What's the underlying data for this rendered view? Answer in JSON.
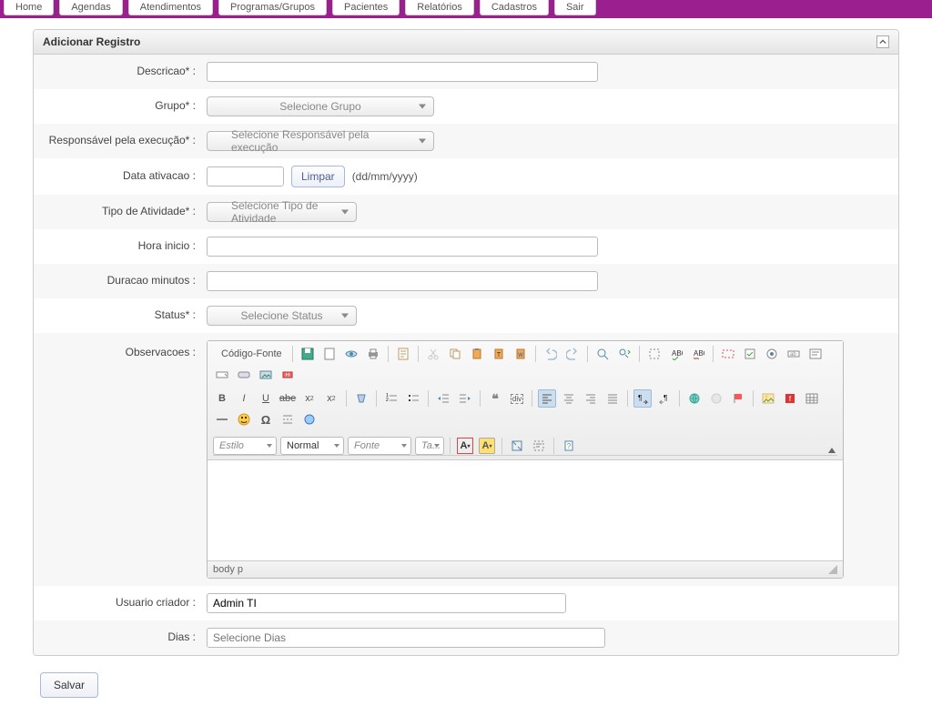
{
  "nav": {
    "items": [
      "Home",
      "Agendas",
      "Atendimentos",
      "Programas/Grupos",
      "Pacientes",
      "Relatórios",
      "Cadastros",
      "Sair"
    ]
  },
  "panel": {
    "title": "Adicionar Registro"
  },
  "labels": {
    "descricao": "Descricao* :",
    "grupo": "Grupo* :",
    "responsavel": "Responsável pela execução* :",
    "data_ativacao": "Data ativacao :",
    "tipo_atividade": "Tipo de Atividade* :",
    "hora_inicio": "Hora inicio :",
    "duracao": "Duracao minutos :",
    "status": "Status* :",
    "observacoes": "Observacoes :",
    "usuario_criador": "Usuario criador :",
    "dias": "Dias :"
  },
  "placeholders": {
    "grupo": "Selecione Grupo",
    "responsavel": "Selecione Responsável pela execução",
    "tipo_atividade": "Selecione Tipo de Atividade",
    "status": "Selecione Status",
    "dias": "Selecione Dias"
  },
  "buttons": {
    "limpar": "Limpar",
    "salvar": "Salvar"
  },
  "hints": {
    "date_format": "(dd/mm/yyyy)"
  },
  "values": {
    "usuario_criador": "Admin TI"
  },
  "editor": {
    "source_label": "Código-Fonte",
    "style": "Estilo",
    "format": "Normal",
    "font": "Fonte",
    "size": "Ta...",
    "path": "body  p"
  }
}
